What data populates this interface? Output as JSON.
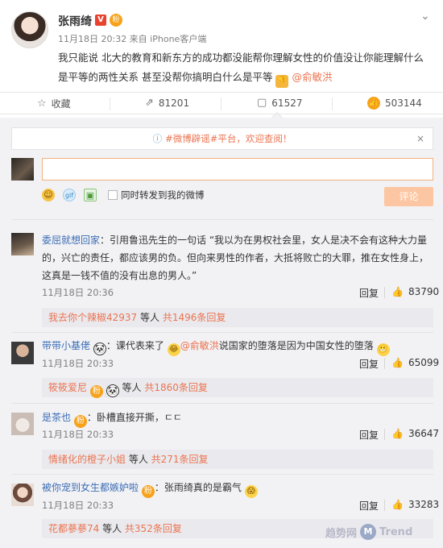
{
  "post": {
    "author": "张雨绮",
    "badge_v": "V",
    "badge_fans": "粉",
    "meta": "11月18日 20:32 来自 iPhone客户端",
    "text": "我只能说 北大的教育和新东方的成功都没能帮你理解女性的价值没让你能理解什么是平等的两性关系 甚至没帮你搞明白什么是平等",
    "mention": "@俞敏洪",
    "more_icon": "chevron-down-icon"
  },
  "actions": {
    "favorite": "收藏",
    "repost": "81201",
    "comment": "61527",
    "like": "503144"
  },
  "notice": {
    "text": "#微博辟谣#平台，欢迎查阅！",
    "close": "×"
  },
  "composer": {
    "input_value": "",
    "repost_label": "同时转发到我的微博",
    "submit": "评论"
  },
  "comments": [
    {
      "user": "委屈就想回家",
      "text": "：引用鲁迅先生的一句话 “我以为在男权社会里，女人是决不会有这种大力量的，兴亡的责任，都应该男的负。但向来男性的作者，大抵将败亡的大罪，推在女性身上，这真是一钱不值的没有出息的男人。”",
      "time": "11月18日 20:36",
      "reply": "回复",
      "likes": "83790",
      "sub_user": "我去你个辣椒42937",
      "sub_mid": " 等人 ",
      "sub_count": "共1496条回复"
    },
    {
      "user": "带带小基佬",
      "text": "：课代表来了",
      "mention": "@俞敏洪",
      "text2": "说国家的堕落是因为中国女性的堕落",
      "time": "11月18日 20:33",
      "reply": "回复",
      "likes": "65099",
      "sub_user": "筱筱爱尼",
      "sub_mid": " 等人 ",
      "sub_count": "共1860条回复"
    },
    {
      "user": "是茶也",
      "text": "：卧槽直接开撕，ㄷㄷ",
      "time": "11月18日 20:33",
      "reply": "回复",
      "likes": "36647",
      "sub_user": "情绪化的橙子小姐",
      "sub_mid": " 等人 ",
      "sub_count": "共271条回复"
    },
    {
      "user": "被你宠到女生都嫉妒啦",
      "text": "：张雨绮真的是霸气",
      "time": "11月18日 20:33",
      "reply": "回复",
      "likes": "33283",
      "sub_user": "花都蔘蔘74",
      "sub_mid": " 等人 ",
      "sub_count": "共352条回复"
    }
  ],
  "watermark": {
    "cn": "趋势网",
    "logo": "M",
    "en": "Trend"
  }
}
